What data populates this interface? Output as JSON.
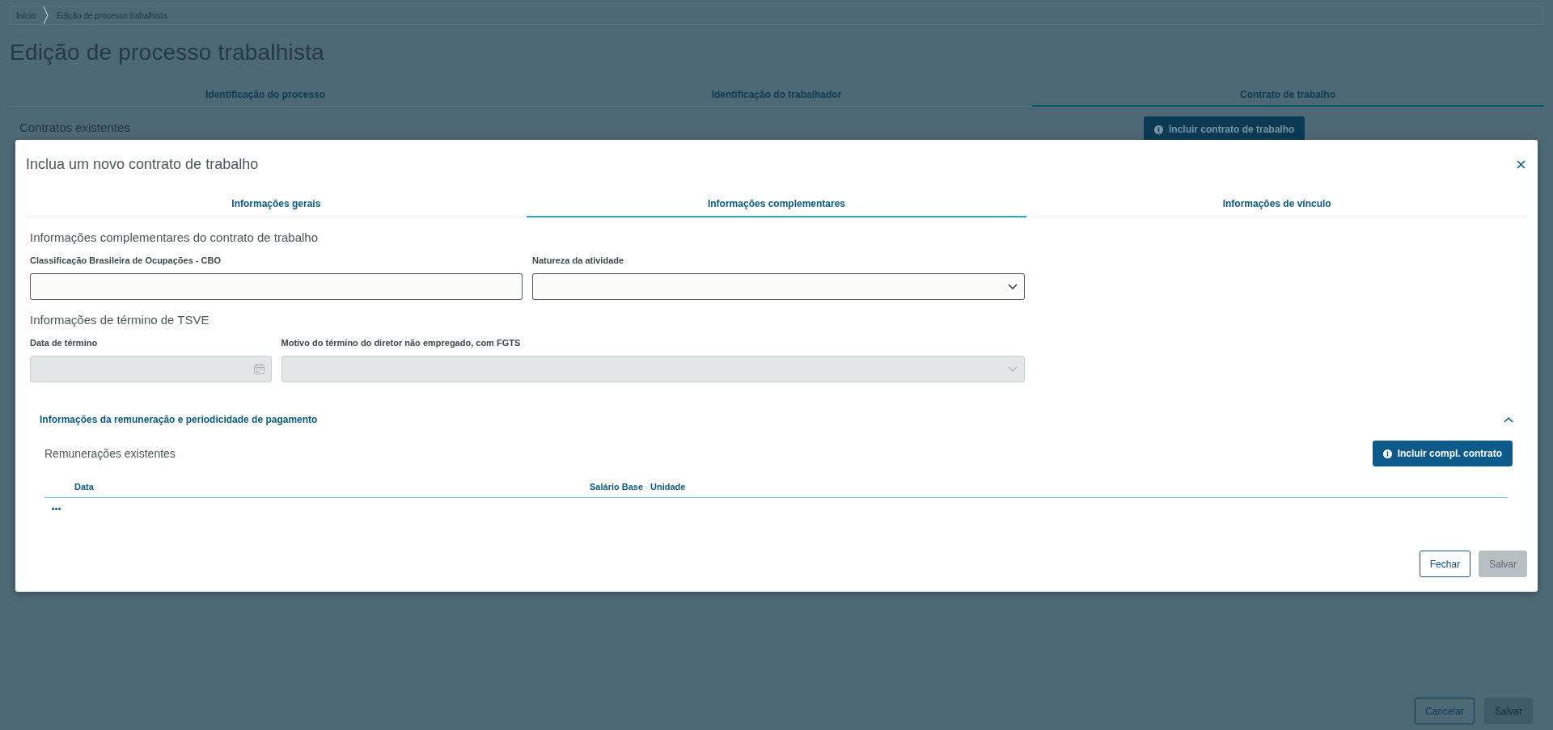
{
  "breadcrumb": [
    {
      "label": "Início"
    },
    {
      "label": "Edição de processo trabalhista"
    }
  ],
  "page_title": "Edição de processo trabalhista",
  "tabs": [
    {
      "label": "Identificação do processo",
      "selected": false
    },
    {
      "label": "Identificação do trabalhador",
      "selected": false
    },
    {
      "label": "Contrato de trabalho",
      "selected": true
    }
  ],
  "contracts": {
    "title": "Contratos existentes",
    "add_button": "Incluir contrato de trabalho"
  },
  "footer_buttons": [
    {
      "label": "Cancelar",
      "kind": "secondary",
      "disabled": false
    },
    {
      "label": "Salvar",
      "kind": "primary",
      "disabled": true
    }
  ],
  "modal": {
    "title": "Inclua um novo contrato de trabalho",
    "tabs": [
      {
        "label": "Informações gerais",
        "selected": false
      },
      {
        "label": "Informações complementares",
        "selected": true
      },
      {
        "label": "Informações de vínculo",
        "selected": false
      }
    ],
    "sections": [
      {
        "title": "Informações complementares do contrato de trabalho",
        "fields": [
          {
            "label": "Classificação Brasileira de Ocupações - CBO",
            "kind": "text",
            "disabled": false
          },
          {
            "label": "Natureza da atividade",
            "kind": "select",
            "disabled": false
          }
        ]
      },
      {
        "title": "Informações de término de TSVE",
        "fields": [
          {
            "label": "Data de término",
            "kind": "date",
            "disabled": true
          },
          {
            "label": "Motivo do término do diretor não empregado, com FGTS",
            "kind": "select",
            "disabled": true
          }
        ]
      }
    ],
    "accordion": {
      "title": "Informações da remuneração e periodicidade de pagamento",
      "expanded": true,
      "list_title": "Remunerações existentes",
      "add_button": "Incluir compl. contrato",
      "columns": [
        "Data",
        "Salário Base",
        "Unidade"
      ]
    },
    "buttons": [
      {
        "label": "Fechar",
        "kind": "secondary",
        "disabled": false
      },
      {
        "label": "Salvar",
        "kind": "primary",
        "disabled": true
      }
    ]
  }
}
